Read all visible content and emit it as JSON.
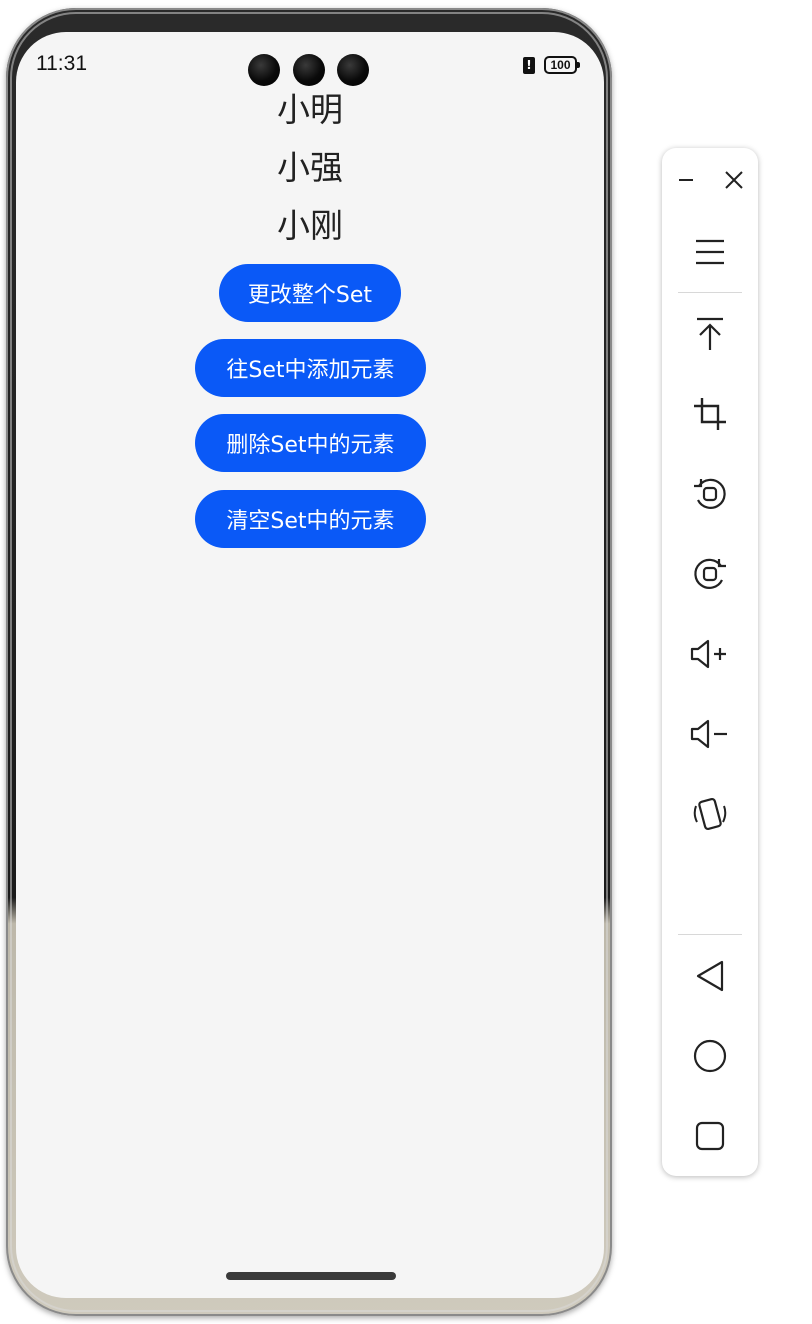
{
  "status_bar": {
    "time": "11:31",
    "alert_symbol": "!",
    "battery_level": "100"
  },
  "names": [
    "小明",
    "小强",
    "小刚"
  ],
  "buttons": {
    "change_set": "更改整个Set",
    "add_to_set": "往Set中添加元素",
    "delete_from_set": "删除Set中的元素",
    "clear_set": "清空Set中的元素"
  },
  "colors": {
    "button_blue": "#0a59f7",
    "screen_bg": "#f5f5f5",
    "text_dark": "#222222"
  },
  "toolbar": {
    "icons": [
      "minimize-icon",
      "close-icon",
      "menu-icon",
      "pin-top-icon",
      "crop-icon",
      "rotate-left-icon",
      "rotate-right-icon",
      "volume-up-icon",
      "volume-down-icon",
      "shake-icon",
      "back-icon",
      "home-icon",
      "recents-icon"
    ]
  }
}
